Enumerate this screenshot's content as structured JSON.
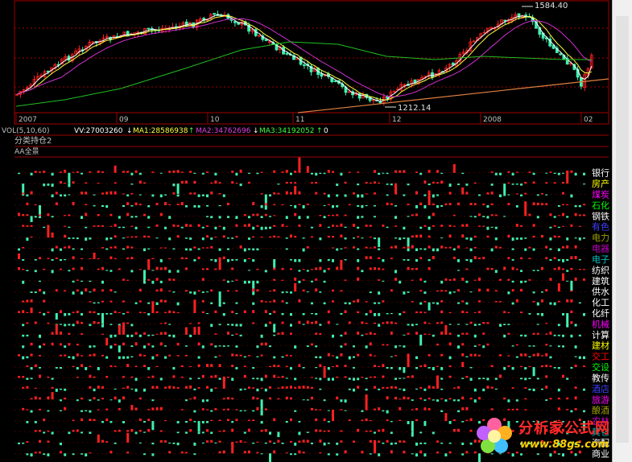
{
  "price_panel": {
    "annotations": {
      "high": "1584.40",
      "low": "1212.14"
    },
    "time_axis": [
      "2007",
      "09",
      "10",
      "11",
      "12",
      "2008",
      "02"
    ]
  },
  "volume_bar": {
    "label": "VOL(5,10,60)",
    "vv": "VV:27003260",
    "ma1": "MA1:28586938",
    "ma2": "MA2:34762696",
    "ma3": "MA3:34192052",
    "last": "0"
  },
  "indicator": {
    "title": "分类持仓2"
  },
  "panorama": {
    "title": "AA全景"
  },
  "sectors": [
    {
      "name": "银行",
      "color": "#ffffff"
    },
    {
      "name": "房产",
      "color": "#ffff00"
    },
    {
      "name": "煤炭",
      "color": "#ff00ff"
    },
    {
      "name": "石化",
      "color": "#00ff00"
    },
    {
      "name": "钢铁",
      "color": "#ffffff"
    },
    {
      "name": "有色",
      "color": "#4040ff"
    },
    {
      "name": "电力",
      "color": "#a0a000"
    },
    {
      "name": "电器",
      "color": "#c000c0"
    },
    {
      "name": "电子",
      "color": "#00c0c0"
    },
    {
      "name": "纺织",
      "color": "#ffffff"
    },
    {
      "name": "建筑",
      "color": "#ffffff"
    },
    {
      "name": "供水",
      "color": "#ffffff"
    },
    {
      "name": "化工",
      "color": "#ffffff"
    },
    {
      "name": "化纤",
      "color": "#ffffff"
    },
    {
      "name": "机械",
      "color": "#ff00ff"
    },
    {
      "name": "计算",
      "color": "#ffffff"
    },
    {
      "name": "建材",
      "color": "#ffff00"
    },
    {
      "name": "交工",
      "color": "#ff0000"
    },
    {
      "name": "交设",
      "color": "#00ff00"
    },
    {
      "name": "教传",
      "color": "#ffffff"
    },
    {
      "name": "酒店",
      "color": "#4040ff"
    },
    {
      "name": "旅游",
      "color": "#ff00ff"
    },
    {
      "name": "酿酒",
      "color": "#a0a000"
    },
    {
      "name": "农林",
      "color": "#c000c0"
    },
    {
      "name": "其它",
      "color": "#00c0c0"
    },
    {
      "name": "汽配",
      "color": "#ffffff"
    },
    {
      "name": "商业",
      "color": "#ffffff"
    }
  ],
  "watermark": {
    "title": "分析家公式网",
    "url": "www.88gs.com"
  },
  "colors": {
    "up": "#ff2020",
    "down": "#40f0b0",
    "ma_white": "#ffffff",
    "ma_yellow": "#ffff40",
    "ma_magenta": "#d030d0",
    "ma_green": "#20c020",
    "trend": "#e08040",
    "divider": "#a00000"
  }
}
